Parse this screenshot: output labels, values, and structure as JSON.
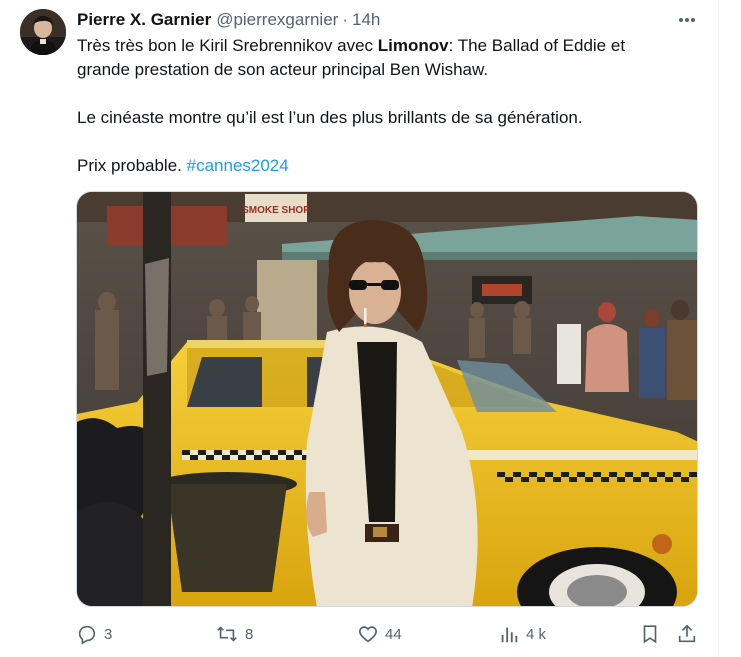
{
  "author": {
    "name": "Pierre X. Garnier",
    "handle": "@pierrexgarnier",
    "separator": "·",
    "time": "14h"
  },
  "post": {
    "line1_before": "Très très bon le Kiril Srebrennikov avec ",
    "line1_bold": "Limonov",
    "line1_after": ": The Ballad of Eddie et",
    "line2": "grande prestation de son acteur principal Ben Wishaw.",
    "paragraph2": "Le cinéaste montre qu’il est l’un des plus brillants de sa génération.",
    "paragraph3_text": "Prix probable. ",
    "hashtag": "#cannes2024"
  },
  "media": {
    "sign_text": "SMOKE SHOP",
    "description_colors": {
      "taxi": "#f2c01c",
      "jacket": "#ece4d0",
      "hair": "#4a2c1a"
    }
  },
  "actions": {
    "reply_count": "3",
    "retweet_count": "8",
    "like_count": "44",
    "views_count": "4 k"
  },
  "colors": {
    "accent": "#1d9bf0",
    "secondary_text": "#536471",
    "border": "#cfd9de"
  }
}
